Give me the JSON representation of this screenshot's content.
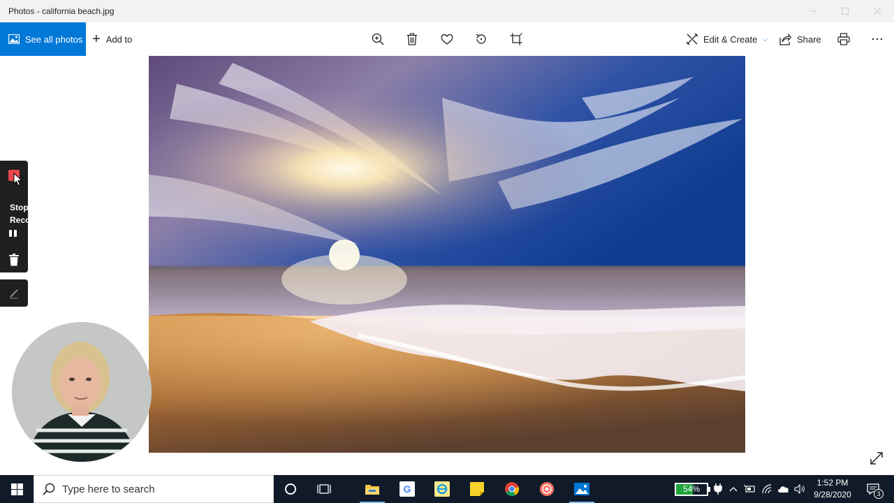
{
  "window": {
    "title": "Photos - california beach.jpg",
    "controls": [
      "minimize",
      "maximize",
      "close"
    ]
  },
  "toolbar": {
    "see_all_label": "See all photos",
    "add_to_label": "Add to",
    "icons": [
      "zoom-icon",
      "delete-icon",
      "favorite-icon",
      "rotate-icon",
      "crop-icon"
    ],
    "edit_create_label": "Edit & Create",
    "share_label": "Share"
  },
  "recorder": {
    "stop_label": "Stop Recording"
  },
  "taskbar": {
    "search_placeholder": "Type here to search",
    "battery_percent": "54%",
    "battery_level": 0.54,
    "time": "1:52 PM",
    "date": "9/28/2020",
    "notification_count": "3",
    "accent_color": "#0078d7"
  }
}
